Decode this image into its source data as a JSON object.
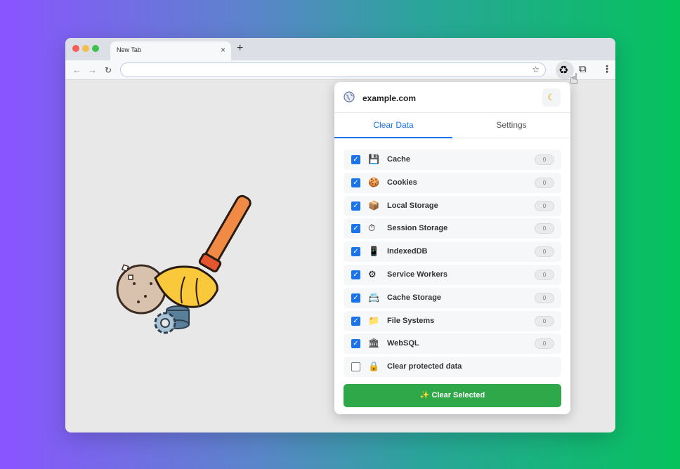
{
  "browser": {
    "tab_title": "New Tab",
    "tab_close": "×",
    "new_tab": "+",
    "back": "←",
    "forward": "→",
    "reload": "↻",
    "star": "☆",
    "menu": "⋮"
  },
  "popup": {
    "domain": "example.com",
    "tabs": [
      {
        "label": "Clear Data",
        "active": true
      },
      {
        "label": "Settings",
        "active": false
      }
    ],
    "items": [
      {
        "label": "Cache",
        "icon": "💾",
        "icon_name": "floppy-disk-icon",
        "checked": true,
        "count": "0"
      },
      {
        "label": "Cookies",
        "icon": "🍪",
        "icon_name": "cookie-icon",
        "checked": true,
        "count": "0"
      },
      {
        "label": "Local Storage",
        "icon": "📦",
        "icon_name": "package-icon",
        "checked": true,
        "count": "0"
      },
      {
        "label": "Session Storage",
        "icon": "⏱",
        "icon_name": "stopwatch-icon",
        "checked": true,
        "count": "0"
      },
      {
        "label": "IndexedDB",
        "icon": "📱",
        "icon_name": "device-icon",
        "checked": true,
        "count": "0"
      },
      {
        "label": "Service Workers",
        "icon": "⚙",
        "icon_name": "gear-icon",
        "checked": true,
        "count": "0"
      },
      {
        "label": "Cache Storage",
        "icon": "📇",
        "icon_name": "card-file-icon",
        "checked": true,
        "count": "0"
      },
      {
        "label": "File Systems",
        "icon": "📁",
        "icon_name": "folder-icon",
        "checked": true,
        "count": "0"
      },
      {
        "label": "WebSQL",
        "icon": "🏛",
        "icon_name": "building-icon",
        "checked": true,
        "count": "0"
      },
      {
        "label": "Clear protected data",
        "icon": "🔒",
        "icon_name": "lock-icon",
        "checked": false,
        "count": null
      }
    ],
    "clear_button": "✨  Clear Selected"
  },
  "colors": {
    "accent": "#1a73e8",
    "button": "#2fa84a"
  }
}
